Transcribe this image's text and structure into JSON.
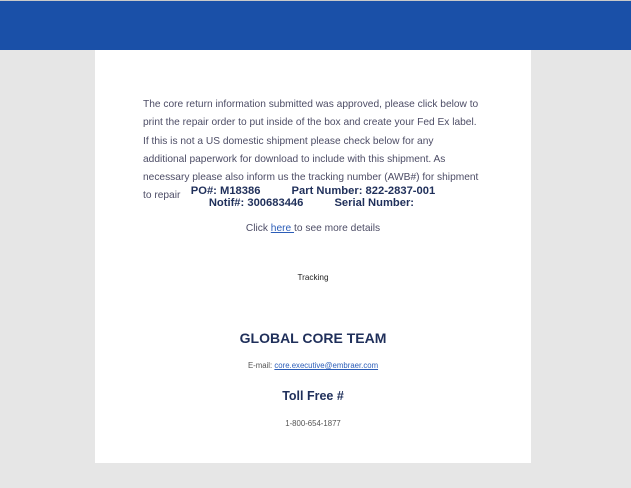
{
  "colors": {
    "header_bar": "#1a50a8",
    "page_background": "#e6e6e6",
    "card_background": "#ffffff",
    "heading_text": "#1f2f5a",
    "link": "#2b5db8"
  },
  "message": {
    "intro": "The core return information submitted was approved, please click below to print the repair order to put inside of the box and create your Fed Ex label. If this is not a US domestic shipment please check below for any additional paperwork for download to include with this shipment. As necessary please also inform us the tracking number (AWB#) for shipment to repair",
    "po_label": "PO#:",
    "po_value": "M18386",
    "part_label": "Part Number:",
    "part_value": "822-2837-001",
    "notif_label": "Notif#:",
    "notif_value": "300683446",
    "serial_label": "Serial Number:",
    "serial_value": "",
    "click_prefix": "Click ",
    "click_link": "here ",
    "click_suffix": "to see more details",
    "tracking_label": "Tracking"
  },
  "contact": {
    "team_heading": "GLOBAL CORE TEAM",
    "email_label": "E-mail: ",
    "email_address": "core.executive@embraer.com",
    "toll_free_heading": "Toll Free #",
    "phone": "1-800-654-1877"
  }
}
